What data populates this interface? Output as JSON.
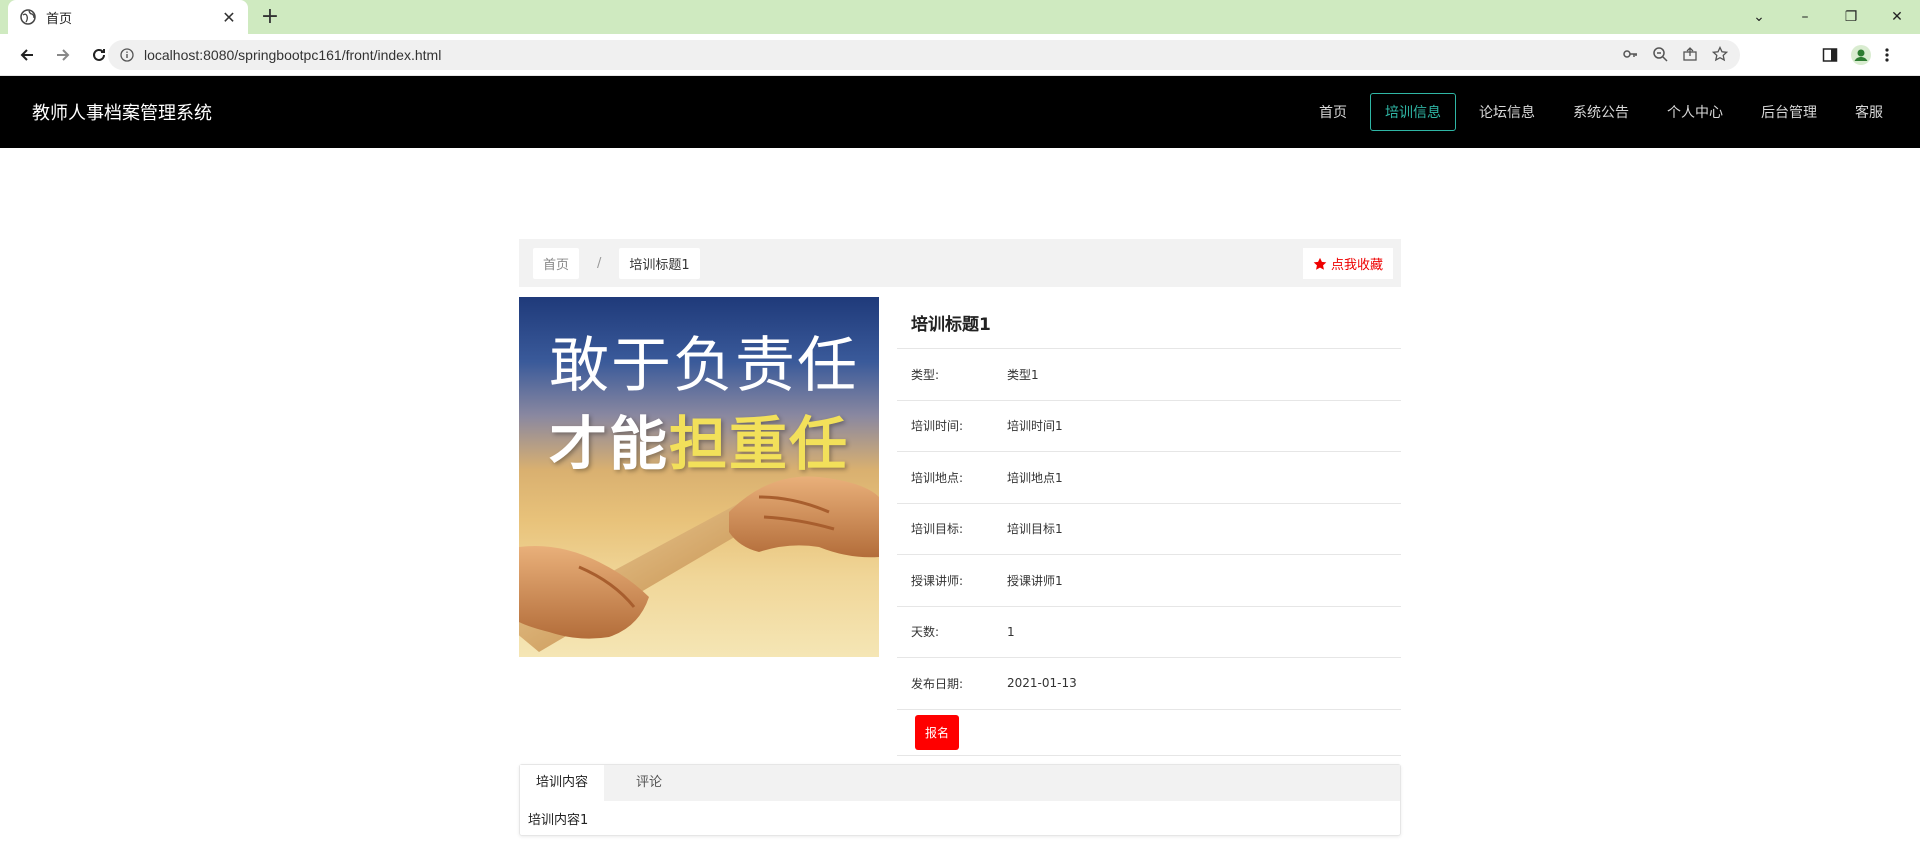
{
  "browser": {
    "tab_title": "首页",
    "url": "localhost:8080/springbootpc161/front/index.html"
  },
  "header": {
    "site_title": "教师人事档案管理系统",
    "menu": [
      "首页",
      "培训信息",
      "论坛信息",
      "系统公告",
      "个人中心",
      "后台管理",
      "客服"
    ],
    "active_menu": "培训信息"
  },
  "breadcrumb": {
    "home": "首页",
    "separator": "/",
    "current": "培训标题1"
  },
  "favorite_label": "点我收藏",
  "poster": {
    "line1": "敢于负责任",
    "line2_white": "才能",
    "line2_yellow": "担重任"
  },
  "detail": {
    "title": "培训标题1",
    "rows": [
      {
        "label": "类型:",
        "value": "类型1"
      },
      {
        "label": "培训时间:",
        "value": "培训时间1"
      },
      {
        "label": "培训地点:",
        "value": "培训地点1"
      },
      {
        "label": "培训目标:",
        "value": "培训目标1"
      },
      {
        "label": "授课讲师:",
        "value": "授课讲师1"
      },
      {
        "label": "天数:",
        "value": "1"
      },
      {
        "label": "发布日期:",
        "value": "2021-01-13"
      }
    ],
    "signup_label": "报名"
  },
  "tabs": {
    "items": [
      "培训内容",
      "评论"
    ],
    "content": "培训内容1"
  },
  "colors": {
    "active_menu": "#2fb6a5",
    "favorite": "#e00000",
    "signup_button": "#ff0000",
    "header_bg": "#000000",
    "tabbar_bg": "#cfeac0"
  }
}
